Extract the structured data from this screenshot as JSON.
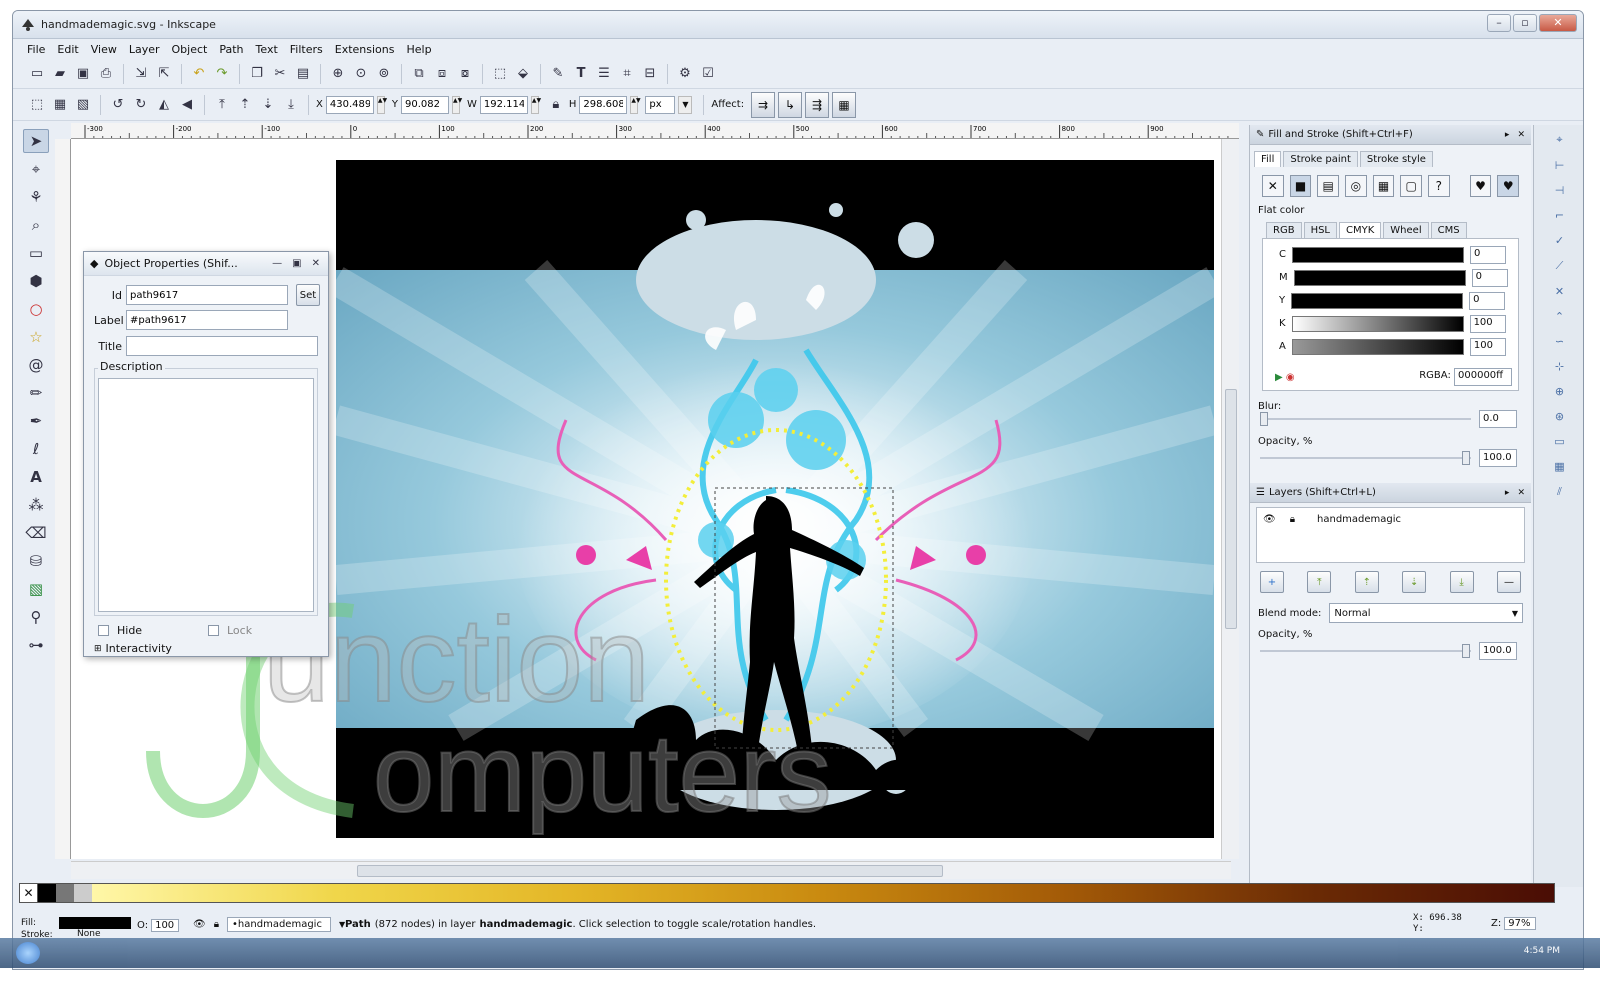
{
  "window": {
    "title": "handmademagic.svg - Inkscape"
  },
  "menu": [
    "File",
    "Edit",
    "View",
    "Layer",
    "Object",
    "Path",
    "Text",
    "Filters",
    "Extensions",
    "Help"
  ],
  "toolbar2": {
    "x_label": "X",
    "x_value": "430.489",
    "y_label": "Y",
    "y_value": "90.082",
    "w_label": "W",
    "w_value": "192.114",
    "h_label": "H",
    "h_value": "298.608",
    "unit": "px",
    "affect_label": "Affect:"
  },
  "ruler_ticks": [
    "-300",
    "-200",
    "-100",
    "0",
    "100",
    "200",
    "300",
    "400",
    "500",
    "600",
    "700",
    "800",
    "900"
  ],
  "object_properties": {
    "title": "Object Properties (Shif...",
    "id_label": "Id",
    "id_value": "path9617",
    "set_label": "Set",
    "label_label": "Label",
    "label_value": "#path9617",
    "title_label": "Title",
    "title_value": "",
    "description_label": "Description",
    "hide_label": "Hide",
    "lock_label": "Lock",
    "interactivity_label": "Interactivity"
  },
  "fill_stroke": {
    "title": "Fill and Stroke (Shift+Ctrl+F)",
    "tabs": [
      "Fill",
      "Stroke paint",
      "Stroke style"
    ],
    "flat_color_label": "Flat color",
    "color_tabs": [
      "RGB",
      "HSL",
      "CMYK",
      "Wheel",
      "CMS"
    ],
    "channels": [
      {
        "name": "C",
        "value": "0"
      },
      {
        "name": "M",
        "value": "0"
      },
      {
        "name": "Y",
        "value": "0"
      },
      {
        "name": "K",
        "value": "100"
      },
      {
        "name": "A",
        "value": "100"
      }
    ],
    "rgba_label": "RGBA:",
    "rgba_value": "000000ff",
    "blur_label": "Blur:",
    "blur_value": "0.0",
    "opacity_label": "Opacity, %",
    "opacity_value": "100.0"
  },
  "layers": {
    "title": "Layers (Shift+Ctrl+L)",
    "layer_name": "handmademagic",
    "blend_label": "Blend mode:",
    "blend_value": "Normal",
    "opacity_label": "Opacity, %",
    "opacity_value": "100.0"
  },
  "status": {
    "fill_label": "Fill:",
    "stroke_label": "Stroke:",
    "stroke_value": "None",
    "opacity_label": "O:",
    "opacity_value": "100",
    "layer_value": "•handmademagic",
    "message_prefix": "Path",
    "message_nodes": "(872 nodes) in layer",
    "message_layer": "handmademagic",
    "message_suffix": ". Click selection to toggle scale/rotation handles.",
    "x_label": "X:",
    "x_value": "696.38",
    "y_label": "Y:",
    "zoom_label": "Z:",
    "zoom_value": "97%"
  },
  "watermark": {
    "line1": "unction",
    "line2": "omputers"
  },
  "taskbar": {
    "time": "4:54 PM"
  },
  "colors": {
    "fill_black": "#000000",
    "accent_cyan": "#33c6e8",
    "accent_pink": "#e83fa8"
  }
}
